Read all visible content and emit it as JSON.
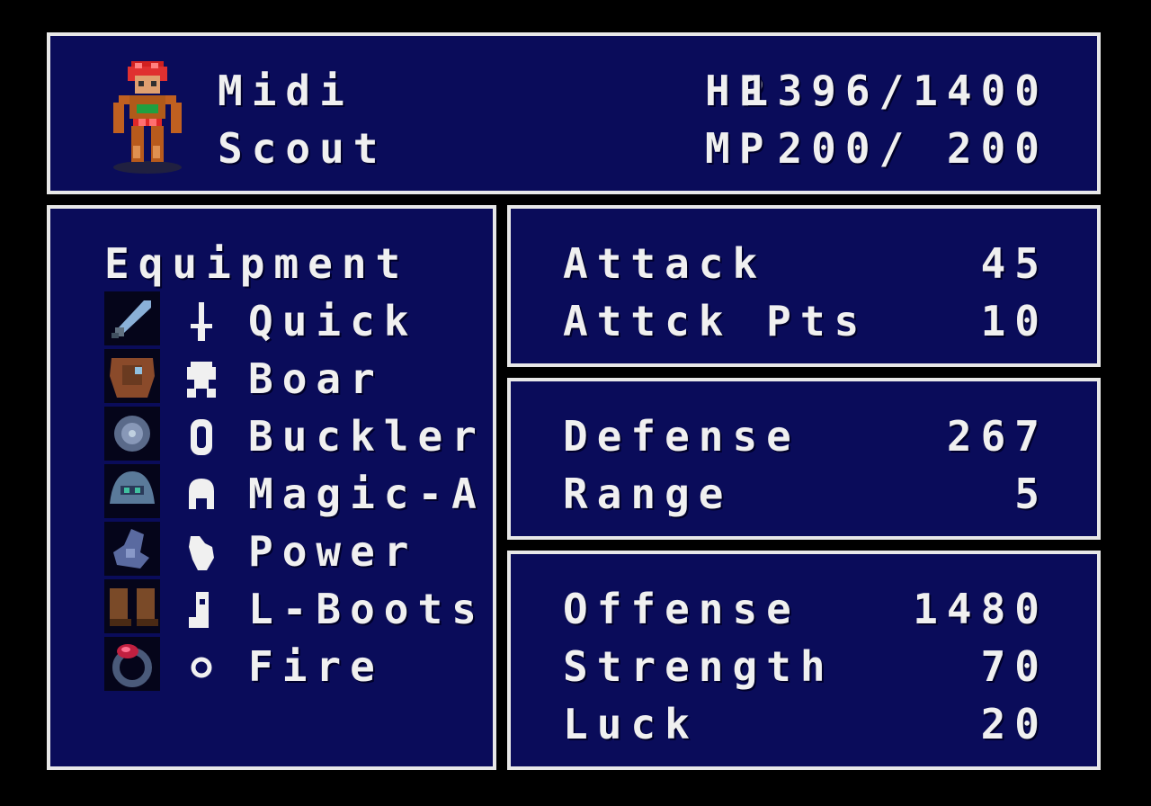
{
  "character": {
    "name": "Midi",
    "class": "Scout",
    "hp_label": "HP",
    "hp_value": "1396/1400",
    "mp_label": "MP",
    "mp_value": " 200/ 200"
  },
  "equipment": {
    "title": "Equipment",
    "items": [
      {
        "slot": "weapon",
        "slot_icon": "dagger-icon",
        "item_icon": "weapon-sword-icon",
        "name": "Quick"
      },
      {
        "slot": "armor",
        "slot_icon": "armor-body-icon",
        "item_icon": "armor-leather-icon",
        "name": "Boar"
      },
      {
        "slot": "shield",
        "slot_icon": "shield-icon",
        "item_icon": "buckler-icon",
        "name": "Buckler"
      },
      {
        "slot": "helmet",
        "slot_icon": "helmet-icon",
        "item_icon": "magic-helm-icon",
        "name": "Magic-A"
      },
      {
        "slot": "gauntlet",
        "slot_icon": "gauntlet-icon",
        "item_icon": "power-glove-icon",
        "name": "Power"
      },
      {
        "slot": "boots",
        "slot_icon": "boot-icon",
        "item_icon": "leather-boots-icon",
        "name": "L-Boots"
      },
      {
        "slot": "ring",
        "slot_icon": "ring-icon",
        "item_icon": "fire-ring-icon",
        "name": "Fire"
      }
    ]
  },
  "stats": {
    "attack": {
      "label": "Attack",
      "value": "45"
    },
    "attack_pts": {
      "label": "Attck Pts",
      "value": "10"
    },
    "defense": {
      "label": "Defense",
      "value": "267"
    },
    "range": {
      "label": "Range",
      "value": "5"
    },
    "offense": {
      "label": "Offense",
      "value": "1480"
    },
    "strength": {
      "label": "Strength",
      "value": "70"
    },
    "luck": {
      "label": "Luck",
      "value": "20"
    }
  },
  "colors": {
    "panel_bg": "#0a0c5a",
    "border": "#e8e8e8",
    "text": "#f0f0f0",
    "background": "#000000"
  }
}
